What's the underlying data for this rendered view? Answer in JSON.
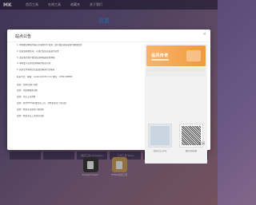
{
  "app": {
    "brand": "MK"
  },
  "nav": {
    "items": [
      "首页工具",
      "在线工具",
      "收藏夹",
      "关于我们"
    ]
  },
  "search": {
    "logo_text": "百度"
  },
  "bg_tiles": [
    "",
    "",
    "",
    "",
    "",
    "",
    "网页工具 Collection",
    "工具工具 Store",
    "在线工具",
    "工具箱"
  ],
  "dock": [
    {
      "label": "Snippet Saver"
    },
    {
      "label": "HTML在线工具"
    }
  ],
  "modal": {
    "title": "站点公告",
    "close": "×",
    "lines": [
      "1. 本站收录网站均来自互联网公开资源，如有侵权请联系我们删除处理",
      "2. 如发现失效链接，可通过反馈页面进行提交",
      "3. 欢迎各位用户推荐优质网站资源到本站",
      "4. 本站会不定期更新网站内容及导航",
      "5. 如需合作请通过页面底部联系方式联系",
      "联系方式：邮箱：nanaus@163.com   微信：1381148888",
      "更新：左侧导航栏调整",
      "更新：添加收藏夹功能",
      "更新：主页工具调整",
      "更新：新增HTML在线预览工具，并修复部分已知问题",
      "更新：修复主页搜索引擎切换",
      "更新：修复主页工具展示问题"
    ],
    "banner_text": "追风传奇",
    "qr_caption_left": "扫码关注公众号",
    "qr_caption_right": "微信扫码加群",
    "ok_label": "关闭"
  }
}
